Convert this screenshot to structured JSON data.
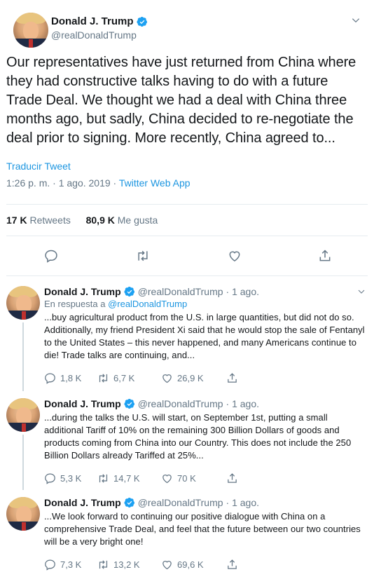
{
  "main_tweet": {
    "author_name": "Donald J. Trump",
    "handle": "@realDonaldTrump",
    "text": "Our representatives have just returned from China where they had constructive talks having to do with a future Trade Deal. We thought we had a deal with China three months ago, but sadly, China decided to re-negotiate the deal prior to signing. More recently, China agreed to...",
    "translate_label": "Traducir Tweet",
    "timestamp": "1:26 p. m. · 1 ago. 2019 · ",
    "source": "Twitter Web App",
    "retweets_count": "17 K",
    "retweets_label": "Retweets",
    "likes_count": "80,9 K",
    "likes_label": "Me gusta"
  },
  "replies": [
    {
      "author_name": "Donald J. Trump",
      "handle": "@realDonaldTrump",
      "date": "· 1 ago.",
      "in_reply_prefix": "En respuesta a ",
      "in_reply_handle": "@realDonaldTrump",
      "text": "...buy agricultural product from the U.S. in large quantities, but did not do so. Additionally, my friend President Xi said that he would stop the sale of Fentanyl to the United States – this never happened, and many Americans continue to die! Trade talks are continuing, and...",
      "replies": "1,8 K",
      "retweets": "6,7 K",
      "likes": "26,9 K"
    },
    {
      "author_name": "Donald J. Trump",
      "handle": "@realDonaldTrump",
      "date": "· 1 ago.",
      "text": "...during the talks the U.S. will start, on September 1st, putting a small additional Tariff of 10% on the remaining 300 Billion Dollars of goods and products coming from China into our Country. This does not include the 250 Billion Dollars already Tariffed at 25%...",
      "replies": "5,3 K",
      "retweets": "14,7 K",
      "likes": "70 K"
    },
    {
      "author_name": "Donald J. Trump",
      "handle": "@realDonaldTrump",
      "date": "· 1 ago.",
      "text": "...We look forward to continuing our positive dialogue with China on a comprehensive Trade Deal, and feel that the future between our two countries will be a very bright one!",
      "replies": "7,3 K",
      "retweets": "13,2 K",
      "likes": "69,6 K"
    }
  ],
  "colors": {
    "link_blue": "#1b95e0",
    "verified_blue": "#1da1f2",
    "muted_gray": "#657786",
    "divider": "#e6ecf0"
  },
  "icons": [
    "verified-badge-icon",
    "chevron-down-icon",
    "reply-icon",
    "retweet-icon",
    "like-icon",
    "share-icon"
  ]
}
